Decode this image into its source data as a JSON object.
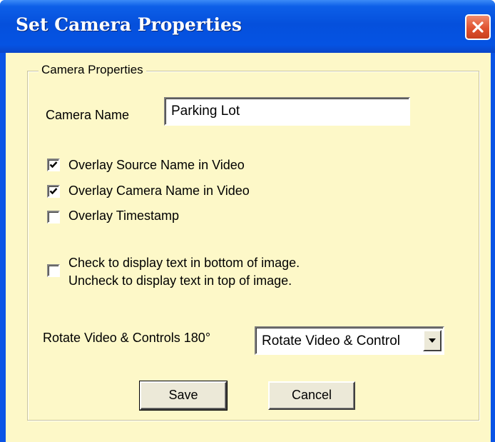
{
  "window": {
    "title": "Set Camera Properties"
  },
  "group": {
    "label": "Camera Properties"
  },
  "camera_name": {
    "label": "Camera Name",
    "value": "Parking Lot"
  },
  "options": [
    {
      "label": "Overlay Source Name in Video",
      "checked": true
    },
    {
      "label": "Overlay Camera Name in Video",
      "checked": true
    },
    {
      "label": "Overlay Timestamp",
      "checked": false
    }
  ],
  "text_position": {
    "line1": "Check to display text in bottom of image.",
    "line2": "Uncheck to display text in top of image.",
    "checked": false
  },
  "rotate": {
    "label": "Rotate Video & Controls 180°",
    "selected": "Rotate Video & Control"
  },
  "buttons": {
    "save": "Save",
    "cancel": "Cancel"
  },
  "colors": {
    "titlebar": "#0550dc",
    "client_background": "#fdf8c8",
    "button_face": "#ece9d8",
    "close_button": "#e0522f"
  }
}
